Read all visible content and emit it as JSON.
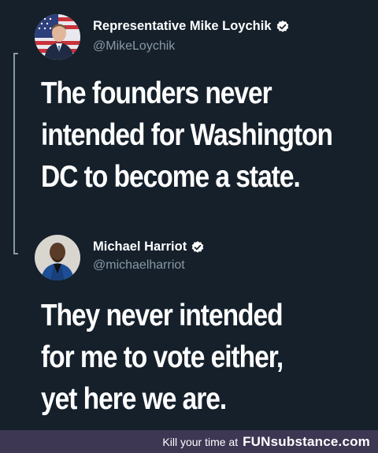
{
  "tweets": [
    {
      "display_name": "Representative Mike Loychik",
      "handle": "@MikeLoychik",
      "verified": true,
      "body_lines": [
        "The founders never",
        "intended for Washington",
        "DC to become a state."
      ]
    },
    {
      "display_name": "Michael Harriot",
      "handle": "@michaelharriot",
      "verified": true,
      "body_lines": [
        "They never intended",
        "for me to vote either,",
        "yet here we are."
      ]
    }
  ],
  "footer": {
    "tagline": "Kill your time at",
    "brand": "FUNsubstance.com"
  },
  "colors": {
    "background": "#15202b",
    "secondary_text": "#8899a6",
    "footer_bar": "#3d3753",
    "verified_badge": "#ffffff"
  },
  "icons": {
    "verified": "verified-badge-icon",
    "avatar_1": "avatar-mike-loychik",
    "avatar_2": "avatar-michael-harriot"
  }
}
